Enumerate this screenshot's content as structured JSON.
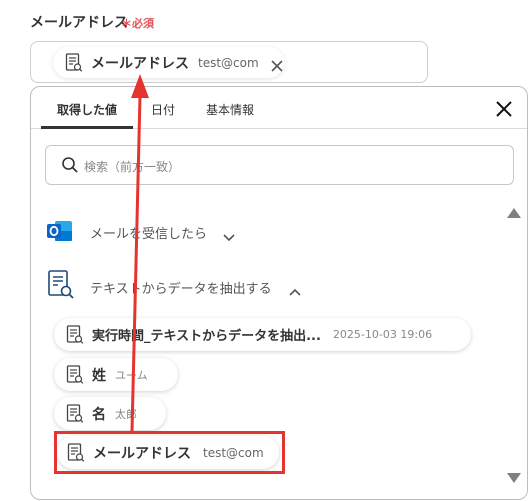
{
  "field": {
    "label": "メールアドレス",
    "required": "＊必須",
    "chip_label": "メールアドレス",
    "chip_value": "test@com"
  },
  "tabs": [
    {
      "label": "取得した値",
      "active": true
    },
    {
      "label": "日付",
      "active": false
    },
    {
      "label": "基本情報",
      "active": false
    }
  ],
  "search": {
    "placeholder": "検索（前方一致）"
  },
  "sections": [
    {
      "title": "メールを受信したら",
      "expanded": false,
      "icon": "outlook-icon"
    },
    {
      "title": "テキストからデータを抽出する",
      "expanded": true,
      "icon": "extract-doc-icon"
    }
  ],
  "items": [
    {
      "label": "実行時間_テキストからデータを抽出...",
      "value": "2025-10-03 19:06"
    },
    {
      "label": "姓",
      "value": "ユーム"
    },
    {
      "label": "名",
      "value": "太郎"
    },
    {
      "label": "メールアドレス",
      "value": "test@com"
    }
  ],
  "colors": {
    "required": "#e8515b",
    "highlight_border": "#e5342f",
    "arrow": "#e5342f",
    "outlook_blue": "#0a64c8"
  }
}
